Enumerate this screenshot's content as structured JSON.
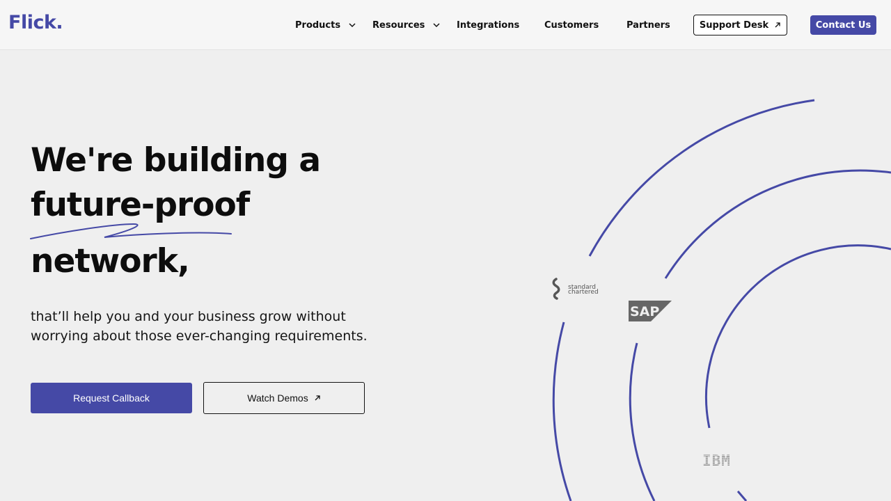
{
  "brand": {
    "logo": "Flick.",
    "accent_color": "#4549a6"
  },
  "nav": {
    "items": [
      {
        "label": "Products",
        "has_dropdown": true
      },
      {
        "label": "Resources",
        "has_dropdown": true
      },
      {
        "label": "Integrations",
        "has_dropdown": false
      },
      {
        "label": "Customers",
        "has_dropdown": false
      },
      {
        "label": "Partners",
        "has_dropdown": false
      }
    ],
    "support_label": "Support Desk",
    "contact_label": "Contact Us"
  },
  "hero": {
    "line1": "We're building a",
    "line2": "future-proof",
    "line3": "network,",
    "subtitle": "that’ll help you and your business grow without worrying about those ever-changing requirements.",
    "primary_cta": "Request Callback",
    "secondary_cta": "Watch Demos"
  },
  "partner_logos": {
    "standard_chartered": "standard chartered",
    "sap": "SAP",
    "ibm": "IBM"
  }
}
